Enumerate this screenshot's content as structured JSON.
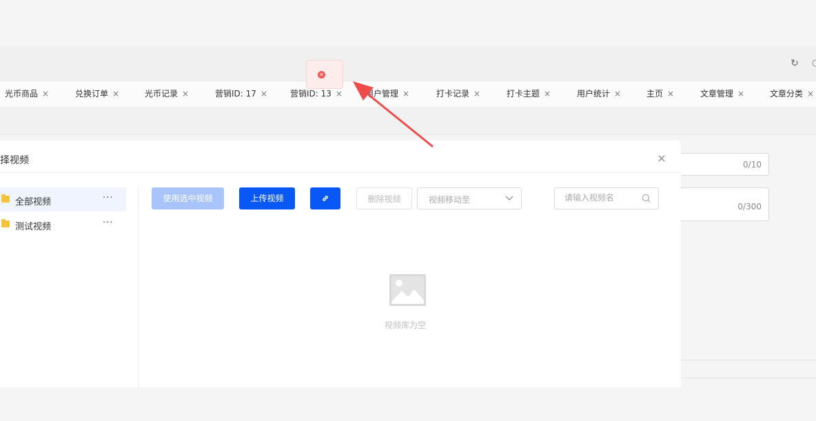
{
  "header": {
    "refresh_icon": "refresh-icon",
    "partial_icon": "settings-icon"
  },
  "tabs": [
    {
      "label": "光币商品"
    },
    {
      "label": "兑换订单"
    },
    {
      "label": "光币记录"
    },
    {
      "label": "营销ID: 17"
    },
    {
      "label": "营销ID: 13"
    },
    {
      "label": "用户管理"
    },
    {
      "label": "打卡记录"
    },
    {
      "label": "打卡主题"
    },
    {
      "label": "用户统计"
    },
    {
      "label": "主页"
    },
    {
      "label": "文章管理"
    },
    {
      "label": "文章分类"
    }
  ],
  "tab_close": "×",
  "background_form": {
    "field1_count": "0/10",
    "field2_count": "0/300"
  },
  "dialog": {
    "title": "择视频",
    "close": "×",
    "folders": [
      {
        "label": "全部视频",
        "more": "···",
        "active": true
      },
      {
        "label": "测试视频",
        "more": "···",
        "active": false
      }
    ],
    "toolbar": {
      "use_selected": "使用选中视频",
      "upload": "上传视频",
      "link_icon": "link-icon",
      "delete": "删除视频",
      "move_placeholder": "视频移动至",
      "search_placeholder": "请输入视频名"
    },
    "empty_text": "视频库为空"
  },
  "toast": {
    "icon": "error-icon",
    "color": "#f25858"
  },
  "annotation": {
    "arrow_color": "#f04b4b"
  }
}
